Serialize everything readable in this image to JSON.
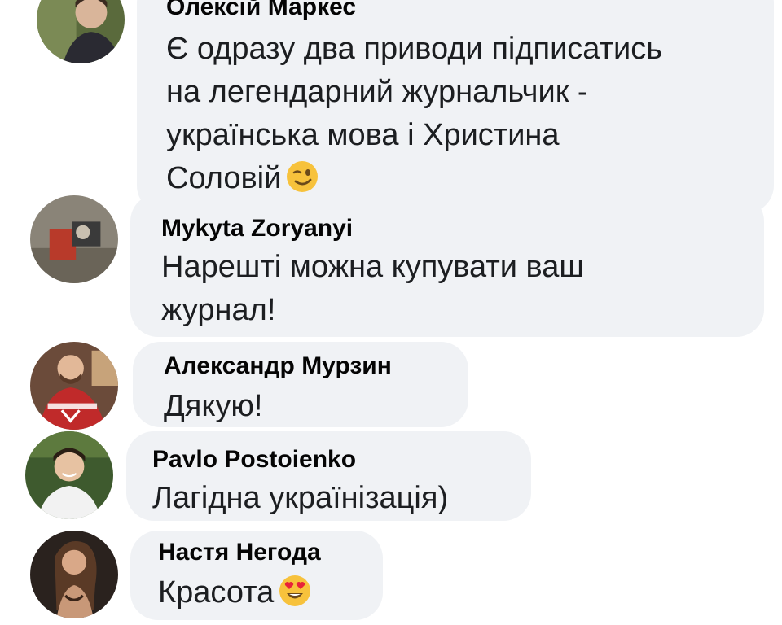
{
  "comments": [
    {
      "author": "Олексій Маркес",
      "text_lines": [
        "Є одразу два приводи підписатись",
        "на легендарний журнальчик -",
        "українська мова і Христина",
        "Соловій"
      ],
      "emoji": "winking-face-emoji"
    },
    {
      "author": "Mykyta Zoryanyi",
      "text_lines": [
        "Нарешті можна купувати ваш",
        "журнал!"
      ]
    },
    {
      "author": "Александр Мурзин",
      "text_lines": [
        "Дякую!"
      ]
    },
    {
      "author": "Pavlo Postoienko",
      "text_lines": [
        "Лагідна українізація)"
      ]
    },
    {
      "author": "Настя Негода",
      "text_lines": [
        "Красота"
      ],
      "emoji": "heart-eyes-emoji"
    }
  ],
  "colors": {
    "bubble": "#f0f2f5",
    "text": "#1c1e21",
    "author": "#050505"
  }
}
